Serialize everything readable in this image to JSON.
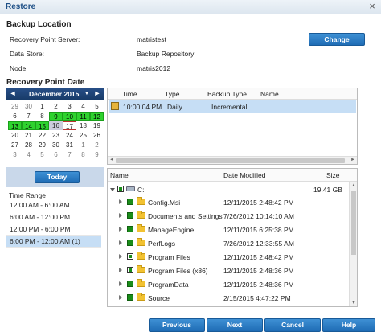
{
  "window": {
    "title": "Restore",
    "close_glyph": "×"
  },
  "backup_location": {
    "heading": "Backup Location",
    "rows": [
      {
        "label": "Recovery Point Server:",
        "value": "matristest"
      },
      {
        "label": "Data Store:",
        "value": "Backup Repository"
      },
      {
        "label": "Node:",
        "value": "matris2012"
      }
    ],
    "change_label": "Change"
  },
  "recovery_point_date": {
    "heading": "Recovery Point Date"
  },
  "calendar": {
    "month_label": "December 2015",
    "prev_glyph": "◄",
    "next_glyph": "►",
    "rows": [
      [
        {
          "d": "29",
          "s": "prev"
        },
        {
          "d": "30",
          "s": "prev"
        },
        {
          "d": "1",
          "s": ""
        },
        {
          "d": "2",
          "s": ""
        },
        {
          "d": "3",
          "s": ""
        },
        {
          "d": "4",
          "s": ""
        },
        {
          "d": "5",
          "s": ""
        }
      ],
      [
        {
          "d": "6",
          "s": ""
        },
        {
          "d": "7",
          "s": ""
        },
        {
          "d": "8",
          "s": ""
        },
        {
          "d": "9",
          "s": "green"
        },
        {
          "d": "10",
          "s": "green"
        },
        {
          "d": "11",
          "s": "green"
        },
        {
          "d": "12",
          "s": "green"
        }
      ],
      [
        {
          "d": "13",
          "s": "green"
        },
        {
          "d": "14",
          "s": "green"
        },
        {
          "d": "15",
          "s": "green"
        },
        {
          "d": "16",
          "s": "sel"
        },
        {
          "d": "17",
          "s": "today"
        },
        {
          "d": "18",
          "s": ""
        },
        {
          "d": "19",
          "s": ""
        }
      ],
      [
        {
          "d": "20",
          "s": ""
        },
        {
          "d": "21",
          "s": ""
        },
        {
          "d": "22",
          "s": ""
        },
        {
          "d": "23",
          "s": ""
        },
        {
          "d": "24",
          "s": ""
        },
        {
          "d": "25",
          "s": ""
        },
        {
          "d": "26",
          "s": ""
        }
      ],
      [
        {
          "d": "27",
          "s": ""
        },
        {
          "d": "28",
          "s": ""
        },
        {
          "d": "29",
          "s": ""
        },
        {
          "d": "30",
          "s": ""
        },
        {
          "d": "31",
          "s": ""
        },
        {
          "d": "1",
          "s": "prev"
        },
        {
          "d": "2",
          "s": "prev"
        }
      ],
      [
        {
          "d": "3",
          "s": "prev"
        },
        {
          "d": "4",
          "s": "prev"
        },
        {
          "d": "5",
          "s": "prev"
        },
        {
          "d": "6",
          "s": "prev"
        },
        {
          "d": "7",
          "s": "prev"
        },
        {
          "d": "8",
          "s": "prev"
        },
        {
          "d": "9",
          "s": "prev"
        }
      ]
    ],
    "today_label": "Today"
  },
  "time_range": {
    "title": "Time Range",
    "items": [
      {
        "label": "12:00 AM - 6:00 AM",
        "selected": false
      },
      {
        "label": "6:00 AM - 12:00 PM",
        "selected": false
      },
      {
        "label": "12:00 PM - 6:00 PM",
        "selected": false
      },
      {
        "label": "6:00 PM - 12:00 AM   (1)",
        "selected": true
      }
    ]
  },
  "recovery_points": {
    "columns": [
      "Time",
      "Type",
      "Backup Type",
      "Name"
    ],
    "rows": [
      {
        "time": "10:00:04 PM",
        "type": "Daily",
        "backup_type": "Incremental",
        "name": ""
      }
    ]
  },
  "file_tree": {
    "columns": {
      "name": "Name",
      "date": "Date Modified",
      "size": "Size"
    },
    "drive": {
      "name": "C:",
      "size": "19.41 GB"
    },
    "items": [
      {
        "name": "Config.Msi",
        "date": "12/11/2015 2:48:42 PM",
        "check": "checked"
      },
      {
        "name": "Documents and Settings",
        "date": "7/26/2012 10:14:10 AM",
        "check": "checked"
      },
      {
        "name": "ManageEngine",
        "date": "12/11/2015 6:25:38 PM",
        "check": "checked"
      },
      {
        "name": "PerfLogs",
        "date": "7/26/2012 12:33:55 AM",
        "check": "checked"
      },
      {
        "name": "Program Files",
        "date": "12/11/2015 2:48:42 PM",
        "check": "partial"
      },
      {
        "name": "Program Files (x86)",
        "date": "12/11/2015 2:48:36 PM",
        "check": "partial"
      },
      {
        "name": "ProgramData",
        "date": "12/11/2015 2:48:36 PM",
        "check": "checked"
      },
      {
        "name": "Source",
        "date": "2/15/2015 4:47:22 PM",
        "check": "checked"
      }
    ]
  },
  "buttons": {
    "previous": "Previous",
    "next": "Next",
    "cancel": "Cancel",
    "help": "Help"
  }
}
